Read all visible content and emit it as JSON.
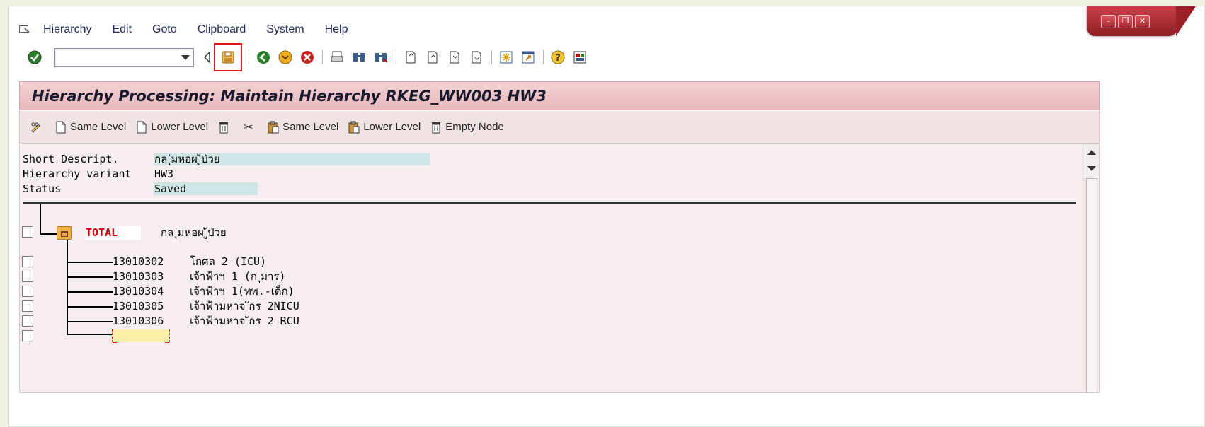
{
  "menubar": {
    "items": [
      {
        "label": "Hierarchy"
      },
      {
        "label": "Edit"
      },
      {
        "label": "Goto"
      },
      {
        "label": "Clipboard"
      },
      {
        "label": "System"
      },
      {
        "label": "Help"
      }
    ]
  },
  "toolbar": {
    "command_field_value": ""
  },
  "title": "Hierarchy Processing: Maintain Hierarchy RKEG_WW003 HW3",
  "app_toolbar": {
    "same_level_1": "Same Level",
    "lower_level_1": "Lower Level",
    "same_level_2": "Same Level",
    "lower_level_2": "Lower Level",
    "empty_node": "Empty Node"
  },
  "header_fields": {
    "short_descript_label": "Short Descript.",
    "short_descript_value": "กล ุ่มหอผ ู้ป่วย",
    "hierarchy_variant_label": "Hierarchy variant",
    "hierarchy_variant_value": "HW3",
    "status_label": "Status",
    "status_value": "Saved"
  },
  "tree": {
    "root": {
      "code": "TOTAL",
      "description": "กล ุ่มหอผ ู้ป่วย"
    },
    "children": [
      {
        "code": "13010302",
        "description": "โกศล 2 (ICU)"
      },
      {
        "code": "13010303",
        "description": "เจ้าฟ้าฯ 1 (ก ุมาร)"
      },
      {
        "code": "13010304",
        "description": "เจ้าฟ้าฯ 1(ทพ.-เด็ก)"
      },
      {
        "code": "13010305",
        "description": "เจ้าฟ้ามหาจ ักร 2NICU"
      },
      {
        "code": "13010306",
        "description": "เจ้าฟ้ามหาจ ักร 2 RCU"
      }
    ]
  },
  "colors": {
    "title_bg": "#e8b8bc",
    "content_bg": "#f6eeee",
    "field_bg": "#cfe4e4",
    "root_code": "#cc0000",
    "highlight_box": "#e0141d"
  }
}
